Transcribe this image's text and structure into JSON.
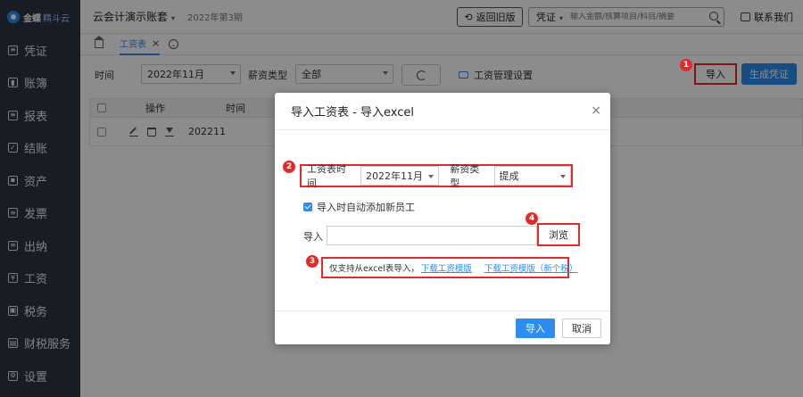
{
  "sidebar": {
    "logo_text": "金蝶",
    "logo_sub": "精斗云",
    "items": [
      {
        "label": "凭证",
        "icon": "voucher-icon",
        "glyph": "≡"
      },
      {
        "label": "账簿",
        "icon": "ledger-icon",
        "glyph": "▮"
      },
      {
        "label": "报表",
        "icon": "report-icon",
        "glyph": "≡"
      },
      {
        "label": "结账",
        "icon": "close-books-icon",
        "glyph": "✓"
      },
      {
        "label": "资产",
        "icon": "asset-icon",
        "glyph": "▪"
      },
      {
        "label": "发票",
        "icon": "invoice-icon",
        "glyph": "≡"
      },
      {
        "label": "出纳",
        "icon": "cashier-icon",
        "glyph": "≡"
      },
      {
        "label": "工资",
        "icon": "salary-icon",
        "glyph": "¥"
      },
      {
        "label": "税务",
        "icon": "tax-icon",
        "glyph": "▣"
      },
      {
        "label": "财税服务",
        "icon": "finance-service-icon",
        "glyph": "▤"
      },
      {
        "label": "设置",
        "icon": "settings-icon",
        "glyph": "⚙"
      }
    ]
  },
  "topbar": {
    "account": "云会计演示账套",
    "period": "2022年第3期",
    "old_version_label": "返回旧版",
    "search_type": "凭证",
    "search_placeholder": "输入金额/核算项目/科目/摘要",
    "contact_label": "联系我们"
  },
  "tabs": {
    "active_tab": "工资表",
    "close_glyph": "×",
    "more_glyph": "⌄"
  },
  "filters": {
    "time_label": "时间",
    "time_value": "2022年11月",
    "salary_type_label": "薪资类型",
    "salary_type_value": "全部",
    "salary_settings_label": "工资管理设置",
    "import_label": "导入",
    "generate_voucher_label": "生成凭证"
  },
  "grid": {
    "columns": [
      "操作",
      "时间"
    ],
    "rows": [
      {
        "time": "202211"
      }
    ]
  },
  "modal": {
    "title": "导入工资表 - 导入excel",
    "close_glyph": "×",
    "period_label": "工资表时间",
    "period_value": "2022年11月",
    "salary_type_label": "薪资类型",
    "salary_type_value": "提成",
    "auto_add_label": "导入时自动添加新员工",
    "auto_add_checked": true,
    "import_label": "导入",
    "browse_label": "浏览",
    "note_text": "仅支持从excel表导入，",
    "template_link": "下载工资模版",
    "template_link_new": "下载工资模版（新个税）",
    "ok_label": "导入",
    "cancel_label": "取消"
  },
  "badges": {
    "step1": "1",
    "step2": "2",
    "step3": "3",
    "step4": "4",
    "color": "#e12b2b"
  },
  "colors": {
    "sidebar_bg": "#2c3343",
    "accent": "#2d8cf0",
    "highlight": "#e12b2b"
  }
}
